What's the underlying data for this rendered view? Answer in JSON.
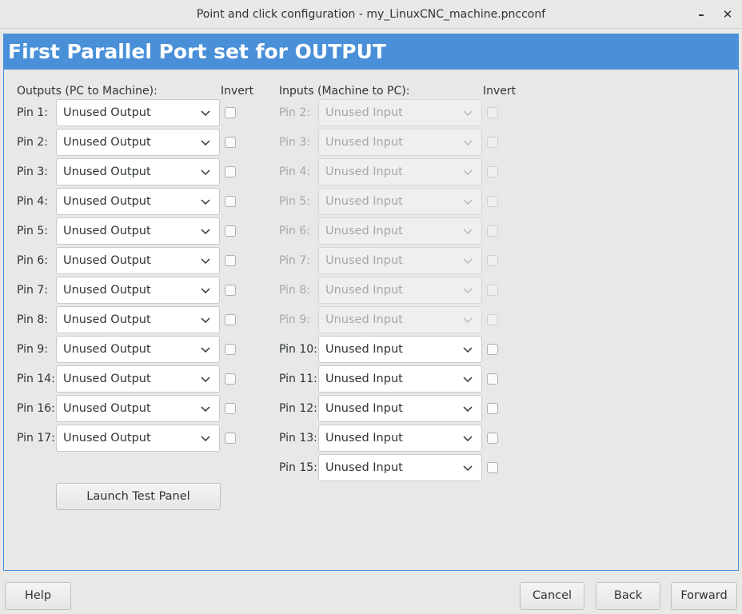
{
  "window": {
    "title": "Point and click configuration - my_LinuxCNC_machine.pncconf",
    "minimize_glyph": "–",
    "close_glyph": "✕"
  },
  "page": {
    "banner": "First Parallel Port set for OUTPUT",
    "outputs_header": "Outputs (PC to Machine):",
    "outputs_invert_header": "Invert",
    "inputs_header": "Inputs (Machine to PC):",
    "inputs_invert_header": "Invert",
    "launch_button": "Launch Test Panel"
  },
  "outputs": [
    {
      "label": "Pin 1:",
      "value": "Unused Output"
    },
    {
      "label": "Pin 2:",
      "value": "Unused Output"
    },
    {
      "label": "Pin 3:",
      "value": "Unused Output"
    },
    {
      "label": "Pin 4:",
      "value": "Unused Output"
    },
    {
      "label": "Pin 5:",
      "value": "Unused Output"
    },
    {
      "label": "Pin 6:",
      "value": "Unused Output"
    },
    {
      "label": "Pin 7:",
      "value": "Unused Output"
    },
    {
      "label": "Pin 8:",
      "value": "Unused Output"
    },
    {
      "label": "Pin 9:",
      "value": "Unused Output"
    },
    {
      "label": "Pin 14:",
      "value": "Unused Output"
    },
    {
      "label": "Pin 16:",
      "value": "Unused Output"
    },
    {
      "label": "Pin 17:",
      "value": "Unused Output"
    }
  ],
  "inputs": [
    {
      "label": "Pin 2:",
      "value": "Unused Input",
      "enabled": false
    },
    {
      "label": "Pin 3:",
      "value": "Unused Input",
      "enabled": false
    },
    {
      "label": "Pin 4:",
      "value": "Unused Input",
      "enabled": false
    },
    {
      "label": "Pin 5:",
      "value": "Unused Input",
      "enabled": false
    },
    {
      "label": "Pin 6:",
      "value": "Unused Input",
      "enabled": false
    },
    {
      "label": "Pin 7:",
      "value": "Unused Input",
      "enabled": false
    },
    {
      "label": "Pin 8:",
      "value": "Unused Input",
      "enabled": false
    },
    {
      "label": "Pin 9:",
      "value": "Unused Input",
      "enabled": false
    },
    {
      "label": "Pin 10:",
      "value": "Unused Input",
      "enabled": true
    },
    {
      "label": "Pin 11:",
      "value": "Unused Input",
      "enabled": true
    },
    {
      "label": "Pin 12:",
      "value": "Unused Input",
      "enabled": true
    },
    {
      "label": "Pin 13:",
      "value": "Unused Input",
      "enabled": true
    },
    {
      "label": "Pin 15:",
      "value": "Unused Input",
      "enabled": true
    }
  ],
  "footer": {
    "help": "Help",
    "cancel": "Cancel",
    "back": "Back",
    "forward": "Forward"
  },
  "icons": {
    "dropdown": "chevron-down-icon"
  },
  "colors": {
    "accent": "#4a90d9",
    "background": "#e8e8e7",
    "text": "#2e3436",
    "disabled_text": "#a6a8a5"
  }
}
